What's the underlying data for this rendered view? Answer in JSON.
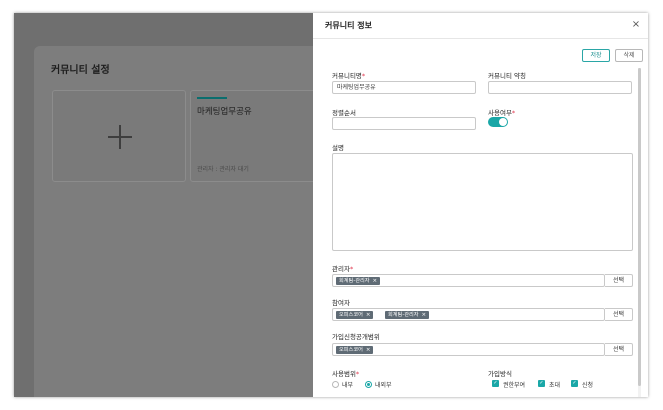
{
  "background": {
    "section_title": "커뮤니티 설정",
    "add_icon": "plus-icon",
    "community_card": {
      "name": "마케팅업무공유",
      "manager": "관리자 : 관리자 대기"
    }
  },
  "modal": {
    "title": "커뮤니티 정보",
    "close_icon": "close-icon",
    "close_label": "×",
    "save_label": "저장",
    "delete_label": "삭제",
    "fields": {
      "name_label": "커뮤니티명",
      "name_value": "마케팅업무공유",
      "abbr_label": "커뮤니티 약칭",
      "abbr_value": "",
      "order_label": "정렬순서",
      "order_value": "",
      "use_label": "사용여부",
      "use_value": true,
      "desc_label": "설명",
      "desc_value": "",
      "admin_label": "관리자",
      "admin_tags": [
        "회계팀-관리자"
      ],
      "participants_label": "참여자",
      "participants_tags": [
        "오피스코어",
        "회계팀-관리자"
      ],
      "join_scope_label": "가입신청공개범위",
      "join_scope_tags": [
        "오피스코어"
      ],
      "select_label": "선택",
      "tag_remove": "×",
      "usage_scope_label": "사용범위",
      "usage_scope_options": [
        "내부",
        "내외부"
      ],
      "usage_scope_selected": "내외부",
      "join_method_label": "가입방식",
      "join_method_options": [
        "권한부여",
        "초대",
        "신청"
      ],
      "required_mark": "*"
    }
  },
  "colors": {
    "accent": "#1aa7a7",
    "required": "#e0334a",
    "tag": "#5f6b75",
    "overlay": "#6f6f6f"
  }
}
